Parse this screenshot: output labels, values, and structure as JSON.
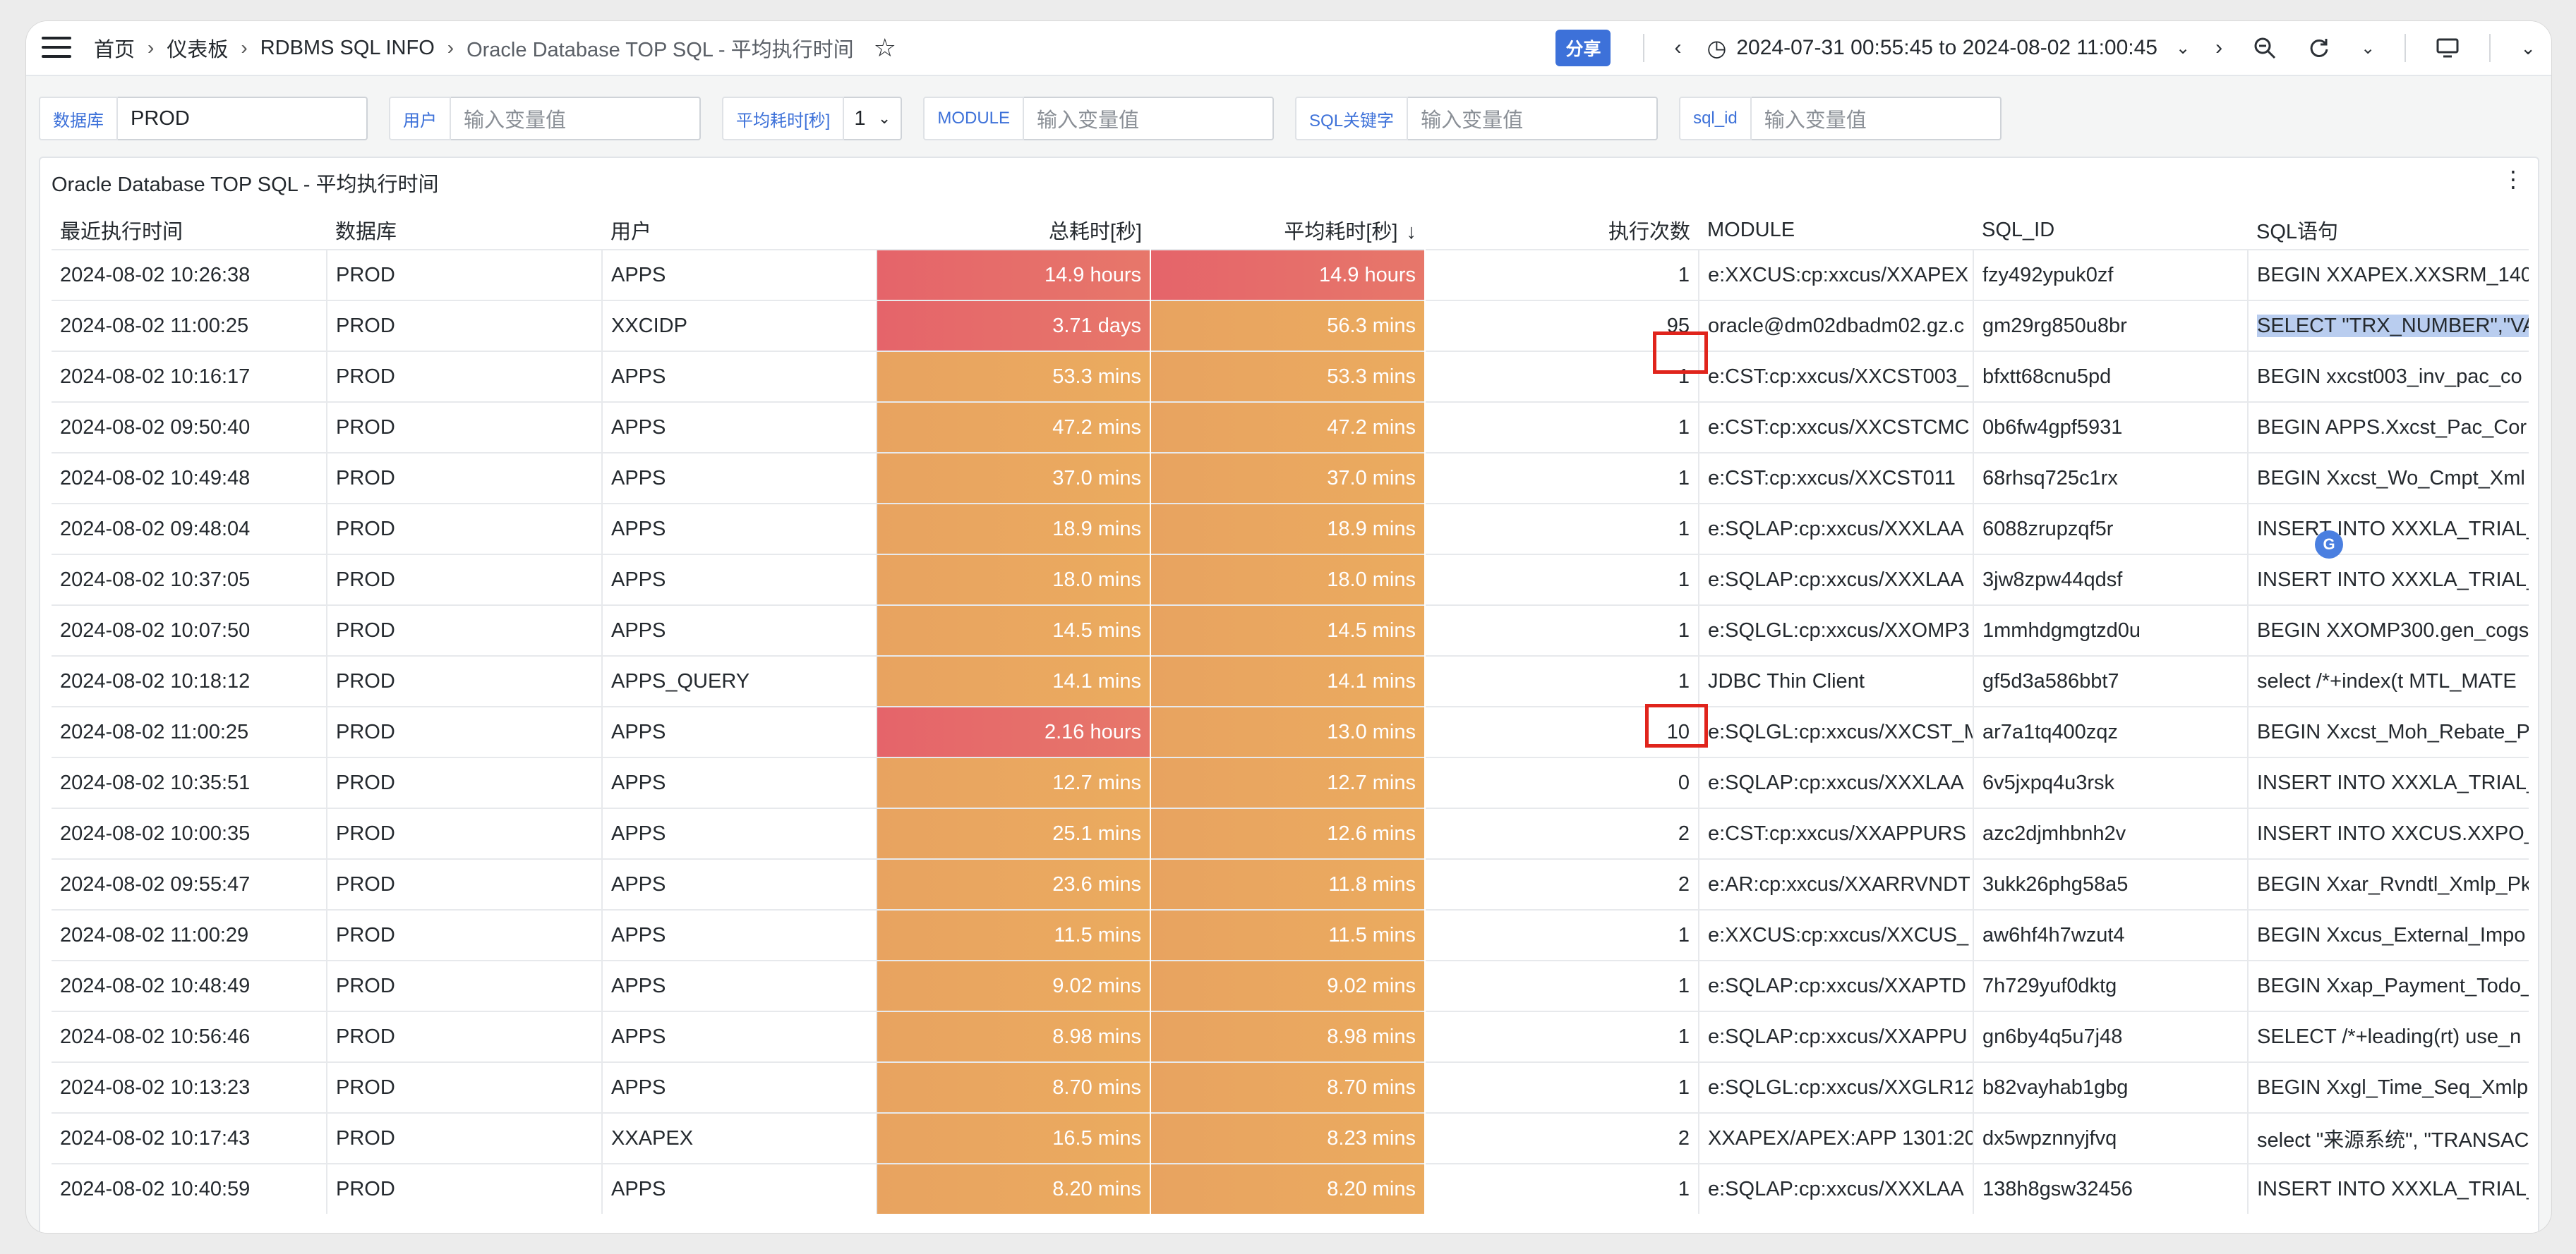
{
  "breadcrumb": [
    "首页",
    "仪表板",
    "RDBMS SQL INFO",
    "Oracle Database TOP SQL - 平均执行时间"
  ],
  "toolbar": {
    "share_label": "分享",
    "time_range": "2024-07-31 00:55:45 to 2024-08-02 11:00:45"
  },
  "variables": [
    {
      "label": "数据库",
      "value": "PROD",
      "placeholder": ""
    },
    {
      "label": "用户",
      "value": "",
      "placeholder": "输入变量值"
    },
    {
      "label": "平均耗时[秒]",
      "value": "1",
      "placeholder": ""
    },
    {
      "label": "MODULE",
      "value": "",
      "placeholder": "输入变量值"
    },
    {
      "label": "SQL关键字",
      "value": "",
      "placeholder": "输入变量值"
    },
    {
      "label": "sql_id",
      "value": "",
      "placeholder": "输入变量值"
    }
  ],
  "panel": {
    "title": "Oracle Database TOP SQL - 平均执行时间",
    "columns": [
      "最近执行时间",
      "数据库",
      "用户",
      "总耗时[秒]",
      "平均耗时[秒]",
      "执行次数",
      "MODULE",
      "SQL_ID",
      "SQL语句"
    ],
    "sort_column": "平均耗时[秒]",
    "sort_direction": "desc",
    "heat_colors": {
      "high": "#e5646a",
      "mid": "#e8a360",
      "low": "#eaaa5e"
    },
    "rows": [
      {
        "time": "2024-08-02 10:26:38",
        "db": "PROD",
        "user": "APPS",
        "total": "14.9 hours",
        "avg": "14.9 hours",
        "execs": "1",
        "module": "e:XXCUS:cp:xxcus/XXAPEX",
        "sql_id": "fzy492ypuk0zf",
        "sql": "BEGIN XXAPEX.XXSRM_140",
        "total_heat": "high",
        "avg_heat": "high"
      },
      {
        "time": "2024-08-02 11:00:25",
        "db": "PROD",
        "user": "XXCIDP",
        "total": "3.71 days",
        "avg": "56.3 mins",
        "execs": "95",
        "module": "oracle@dm02dbadm02.gz.c",
        "sql_id": "gm29rg850u8br",
        "sql": "SELECT \"TRX_NUMBER\",\"VA",
        "total_heat": "high",
        "avg_heat": "mid"
      },
      {
        "time": "2024-08-02 10:16:17",
        "db": "PROD",
        "user": "APPS",
        "total": "53.3 mins",
        "avg": "53.3 mins",
        "execs": "1",
        "module": "e:CST:cp:xxcus/XXCST003_",
        "sql_id": "bfxtt68cnu5pd",
        "sql": "BEGIN xxcst003_inv_pac_co",
        "total_heat": "mid",
        "avg_heat": "mid"
      },
      {
        "time": "2024-08-02 09:50:40",
        "db": "PROD",
        "user": "APPS",
        "total": "47.2 mins",
        "avg": "47.2 mins",
        "execs": "1",
        "module": "e:CST:cp:xxcus/XXCSTCMC",
        "sql_id": "0b6fw4gpf5931",
        "sql": "BEGIN APPS.Xxcst_Pac_Cor",
        "total_heat": "mid",
        "avg_heat": "mid"
      },
      {
        "time": "2024-08-02 10:49:48",
        "db": "PROD",
        "user": "APPS",
        "total": "37.0 mins",
        "avg": "37.0 mins",
        "execs": "1",
        "module": "e:CST:cp:xxcus/XXCST011",
        "sql_id": "68rhsq725c1rx",
        "sql": "BEGIN Xxcst_Wo_Cmpt_Xml",
        "total_heat": "mid",
        "avg_heat": "mid"
      },
      {
        "time": "2024-08-02 09:48:04",
        "db": "PROD",
        "user": "APPS",
        "total": "18.9 mins",
        "avg": "18.9 mins",
        "execs": "1",
        "module": "e:SQLAP:cp:xxcus/XXXLAA",
        "sql_id": "6088zrupzqf5r",
        "sql": "INSERT INTO XXXLA_TRIAL_",
        "total_heat": "mid",
        "avg_heat": "mid"
      },
      {
        "time": "2024-08-02 10:37:05",
        "db": "PROD",
        "user": "APPS",
        "total": "18.0 mins",
        "avg": "18.0 mins",
        "execs": "1",
        "module": "e:SQLAP:cp:xxcus/XXXLAA",
        "sql_id": "3jw8zpw44qdsf",
        "sql": "INSERT INTO XXXLA_TRIAL_",
        "total_heat": "mid",
        "avg_heat": "mid"
      },
      {
        "time": "2024-08-02 10:07:50",
        "db": "PROD",
        "user": "APPS",
        "total": "14.5 mins",
        "avg": "14.5 mins",
        "execs": "1",
        "module": "e:SQLGL:cp:xxcus/XXOMP3",
        "sql_id": "1mmhdgmgtzd0u",
        "sql": "BEGIN XXOMP300.gen_cogs",
        "total_heat": "mid",
        "avg_heat": "mid"
      },
      {
        "time": "2024-08-02 10:18:12",
        "db": "PROD",
        "user": "APPS_QUERY",
        "total": "14.1 mins",
        "avg": "14.1 mins",
        "execs": "1",
        "module": "JDBC Thin Client",
        "sql_id": "gf5d3a586bbt7",
        "sql": "select /*+index(t MTL_MATE",
        "total_heat": "mid",
        "avg_heat": "mid"
      },
      {
        "time": "2024-08-02 11:00:25",
        "db": "PROD",
        "user": "APPS",
        "total": "2.16 hours",
        "avg": "13.0 mins",
        "execs": "10",
        "module": "e:SQLGL:cp:xxcus/XXCST_M",
        "sql_id": "ar7a1tq400zqz",
        "sql": "BEGIN Xxcst_Moh_Rebate_P",
        "total_heat": "high",
        "avg_heat": "mid"
      },
      {
        "time": "2024-08-02 10:35:51",
        "db": "PROD",
        "user": "APPS",
        "total": "12.7 mins",
        "avg": "12.7 mins",
        "execs": "0",
        "module": "e:SQLAP:cp:xxcus/XXXLAA",
        "sql_id": "6v5jxpq4u3rsk",
        "sql": "INSERT INTO XXXLA_TRIAL_",
        "total_heat": "mid",
        "avg_heat": "mid"
      },
      {
        "time": "2024-08-02 10:00:35",
        "db": "PROD",
        "user": "APPS",
        "total": "25.1 mins",
        "avg": "12.6 mins",
        "execs": "2",
        "module": "e:CST:cp:xxcus/XXAPPURS",
        "sql_id": "azc2djmhbnh2v",
        "sql": "INSERT INTO XXCUS.XXPO_",
        "total_heat": "mid",
        "avg_heat": "mid"
      },
      {
        "time": "2024-08-02 09:55:47",
        "db": "PROD",
        "user": "APPS",
        "total": "23.6 mins",
        "avg": "11.8 mins",
        "execs": "2",
        "module": "e:AR:cp:xxcus/XXARRVNDT",
        "sql_id": "3ukk26phg58a5",
        "sql": "BEGIN Xxar_Rvndtl_Xmlp_Pk",
        "total_heat": "mid",
        "avg_heat": "mid"
      },
      {
        "time": "2024-08-02 11:00:29",
        "db": "PROD",
        "user": "APPS",
        "total": "11.5 mins",
        "avg": "11.5 mins",
        "execs": "1",
        "module": "e:XXCUS:cp:xxcus/XXCUS_",
        "sql_id": "aw6hf4h7wzut4",
        "sql": "BEGIN Xxcus_External_Impo",
        "total_heat": "mid",
        "avg_heat": "mid"
      },
      {
        "time": "2024-08-02 10:48:49",
        "db": "PROD",
        "user": "APPS",
        "total": "9.02 mins",
        "avg": "9.02 mins",
        "execs": "1",
        "module": "e:SQLAP:cp:xxcus/XXAPTD",
        "sql_id": "7h729yuf0dktg",
        "sql": "BEGIN Xxap_Payment_Todo_",
        "total_heat": "mid",
        "avg_heat": "mid"
      },
      {
        "time": "2024-08-02 10:56:46",
        "db": "PROD",
        "user": "APPS",
        "total": "8.98 mins",
        "avg": "8.98 mins",
        "execs": "1",
        "module": "e:SQLAP:cp:xxcus/XXAPPU",
        "sql_id": "gn6by4q5u7j48",
        "sql": "SELECT /*+leading(rt) use_n",
        "total_heat": "mid",
        "avg_heat": "mid"
      },
      {
        "time": "2024-08-02 10:13:23",
        "db": "PROD",
        "user": "APPS",
        "total": "8.70 mins",
        "avg": "8.70 mins",
        "execs": "1",
        "module": "e:SQLGL:cp:xxcus/XXGLR12",
        "sql_id": "b82vayhab1gbg",
        "sql": "BEGIN Xxgl_Time_Seq_Xmlp",
        "total_heat": "mid",
        "avg_heat": "mid"
      },
      {
        "time": "2024-08-02 10:17:43",
        "db": "PROD",
        "user": "XXAPEX",
        "total": "16.5 mins",
        "avg": "8.23 mins",
        "execs": "2",
        "module": "XXAPEX/APEX:APP 1301:20",
        "sql_id": "dx5wpznnyjfvq",
        "sql": "select \"来源系统\", \"TRANSAC",
        "total_heat": "mid",
        "avg_heat": "mid"
      },
      {
        "time": "2024-08-02 10:40:59",
        "db": "PROD",
        "user": "APPS",
        "total": "8.20 mins",
        "avg": "8.20 mins",
        "execs": "1",
        "module": "e:SQLAP:cp:xxcus/XXXLAA",
        "sql_id": "138h8gsw32456",
        "sql": "INSERT INTO XXXLA_TRIAL_",
        "total_heat": "mid",
        "avg_heat": "mid"
      }
    ]
  }
}
